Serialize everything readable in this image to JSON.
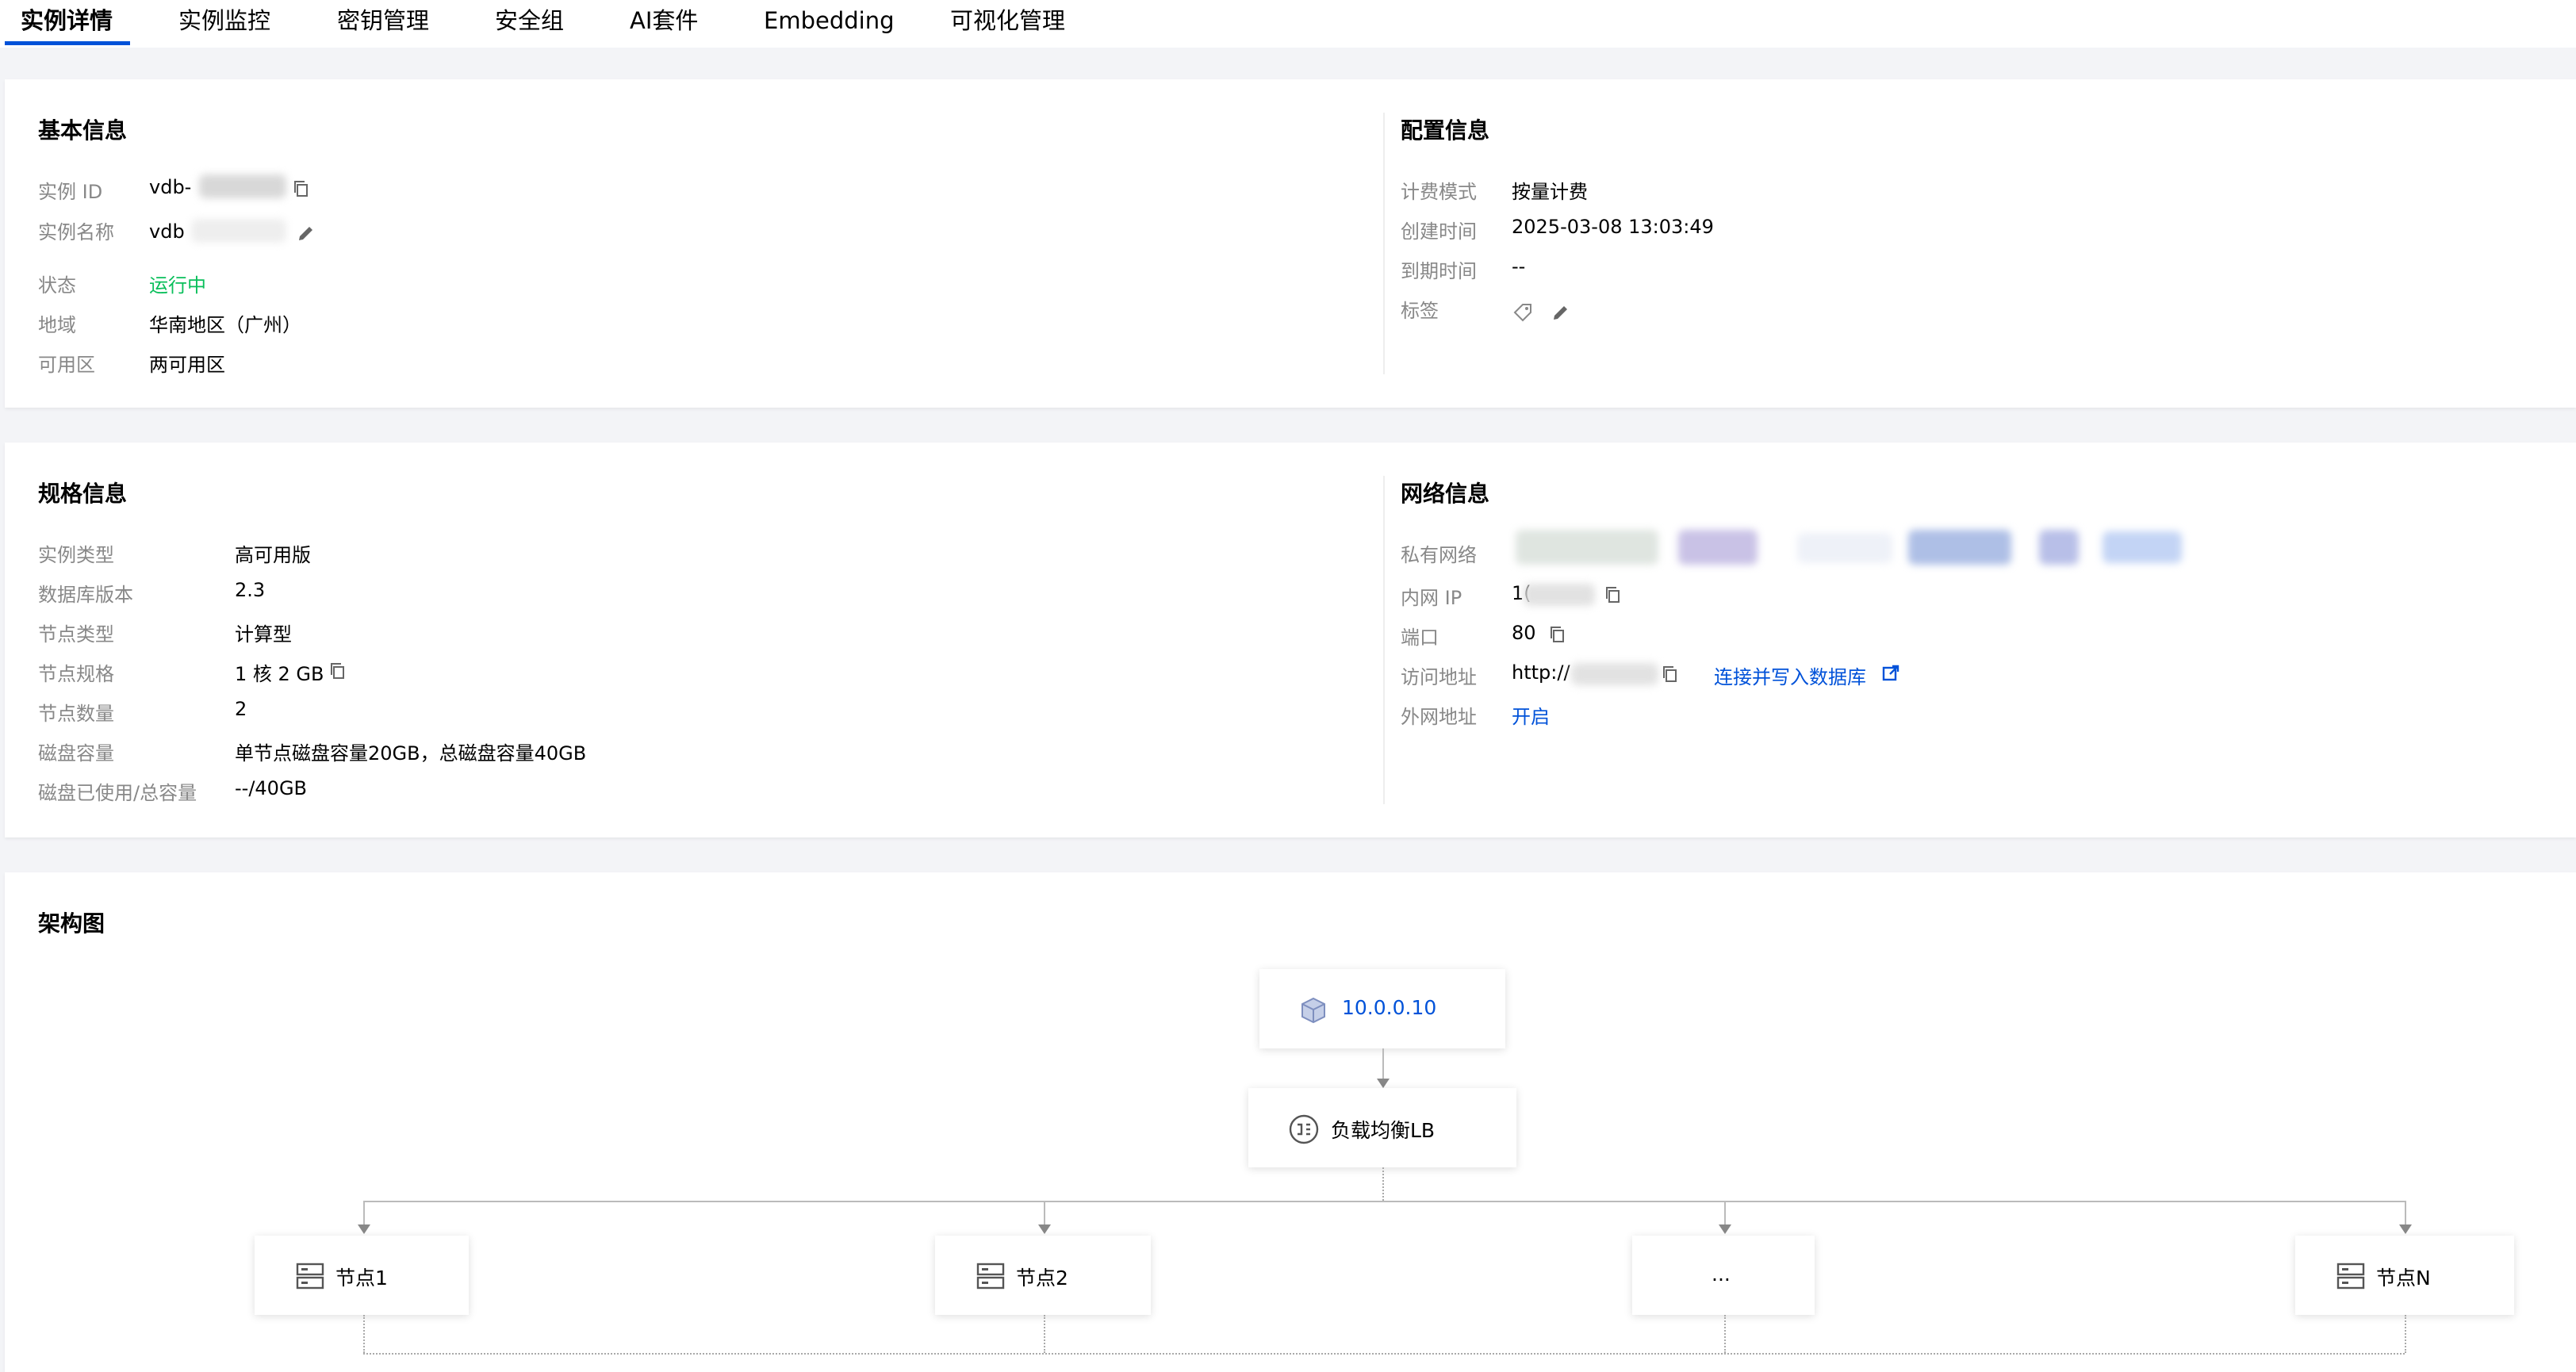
{
  "tabs": [
    {
      "label": "实例详情"
    },
    {
      "label": "实例监控"
    },
    {
      "label": "密钥管理"
    },
    {
      "label": "安全组"
    },
    {
      "label": "AI套件"
    },
    {
      "label": "Embedding"
    },
    {
      "label": "可视化管理"
    }
  ],
  "basic": {
    "title": "基本信息",
    "id_label": "实例 ID",
    "id_value": "vdb-",
    "name_label": "实例名称",
    "name_value": "vdb",
    "status_label": "状态",
    "status_value": "运行中",
    "region_label": "地域",
    "region_value": "华南地区（广州）",
    "zone_label": "可用区",
    "zone_value": "两可用区"
  },
  "config": {
    "title": "配置信息",
    "billing_label": "计费模式",
    "billing_value": "按量计费",
    "created_label": "创建时间",
    "created_value": "2025-03-08 13:03:49",
    "expire_label": "到期时间",
    "expire_value": "--",
    "tag_label": "标签"
  },
  "spec": {
    "title": "规格信息",
    "type_label": "实例类型",
    "type_value": "高可用版",
    "version_label": "数据库版本",
    "version_value": "2.3",
    "node_type_label": "节点类型",
    "node_type_value": "计算型",
    "node_spec_label": "节点规格",
    "node_spec_value": "1 核 2 GB",
    "node_count_label": "节点数量",
    "node_count_value": "2",
    "disk_label": "磁盘容量",
    "disk_value": "单节点磁盘容量20GB，总磁盘容量40GB",
    "disk_used_label": "磁盘已使用/总容量",
    "disk_used_value": "--/40GB"
  },
  "network": {
    "title": "网络信息",
    "vpc_label": "私有网络",
    "ip_label": "内网 IP",
    "ip_value": "1(",
    "port_label": "端口",
    "port_value": "80",
    "access_label": "访问地址",
    "access_value": "http://",
    "connect_link": "连接并写入数据库",
    "public_label": "外网地址",
    "public_link": "开启"
  },
  "arch": {
    "title": "架构图",
    "vip": "10.0.0.10",
    "lb": "负载均衡LB",
    "nodes": [
      "节点1",
      "节点2",
      "...",
      "节点N"
    ]
  },
  "colors": {
    "accent": "#0052d9",
    "running": "#0abf5b",
    "label": "#888888",
    "background": "#f3f4f7"
  },
  "icons": [
    "copy-icon",
    "edit-icon",
    "tag-icon",
    "external-link-icon",
    "cube-icon",
    "load-balancer-icon",
    "server-icon"
  ]
}
